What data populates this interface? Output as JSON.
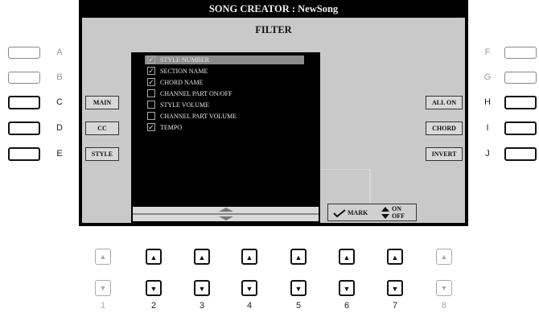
{
  "screen": {
    "title": "SONG CREATOR : NewSong",
    "panel_title": "FILTER"
  },
  "left_buttons": [
    {
      "key": "A",
      "label": ""
    },
    {
      "key": "B",
      "label": ""
    },
    {
      "key": "C",
      "label": "MAIN"
    },
    {
      "key": "D",
      "label": "CC"
    },
    {
      "key": "E",
      "label": "STYLE"
    }
  ],
  "right_buttons": [
    {
      "key": "F",
      "label": ""
    },
    {
      "key": "G",
      "label": ""
    },
    {
      "key": "H",
      "label": "ALL ON"
    },
    {
      "key": "I",
      "label": "CHORD"
    },
    {
      "key": "J",
      "label": "INVERT"
    }
  ],
  "filter_items": [
    {
      "label": "STYLE NUMBER",
      "checked": true,
      "selected": true
    },
    {
      "label": "SECTION NAME",
      "checked": true,
      "selected": false
    },
    {
      "label": "CHORD NAME",
      "checked": true,
      "selected": false
    },
    {
      "label": "CHANNEL PART ON/OFF",
      "checked": false,
      "selected": false
    },
    {
      "label": "STYLE VOLUME",
      "checked": false,
      "selected": false
    },
    {
      "label": "CHANNEL PART VOLUME",
      "checked": false,
      "selected": false
    },
    {
      "label": "TEMPO",
      "checked": true,
      "selected": false
    }
  ],
  "mark_control": {
    "mark_label": "MARK",
    "on_label": "ON",
    "off_label": "OFF"
  },
  "bottom_numbers": [
    "1",
    "2",
    "3",
    "4",
    "5",
    "6",
    "7",
    "8"
  ]
}
